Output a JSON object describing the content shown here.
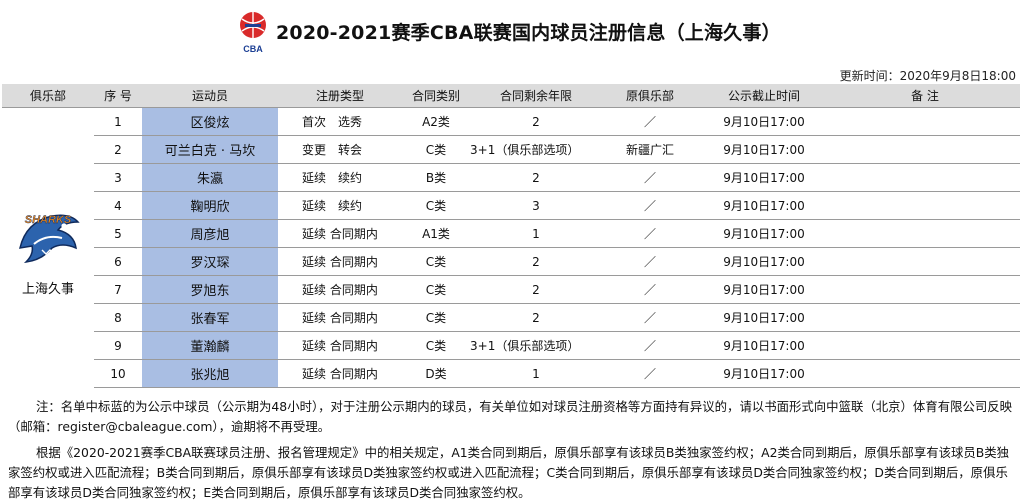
{
  "header": {
    "title": "2020-2021赛季CBA联赛国内球员注册信息（上海久事）",
    "updated_label": "更新时间：",
    "updated_value": "2020年9月8日18:00",
    "cba_logo_text": "CBA"
  },
  "table": {
    "columns": [
      "俱乐部",
      "序 号",
      "运动员",
      "注册类型",
      "合同类别",
      "合同剩余年限",
      "原俱乐部",
      "公示截止时间",
      "备 注"
    ],
    "club": {
      "name": "上海久事",
      "logo_text": "SHARKS"
    },
    "rows": [
      {
        "no": "1",
        "player": "区俊炫",
        "reg": "首次　选秀",
        "cat": "A2类",
        "years": "2",
        "prev": "／",
        "deadline": "9月10日17:00",
        "note": ""
      },
      {
        "no": "2",
        "player": "可兰白克 · 马坎",
        "reg": "变更　转会",
        "cat": "C类",
        "years": "3+1（俱乐部选项）",
        "prev": "新疆广汇",
        "deadline": "9月10日17:00",
        "note": ""
      },
      {
        "no": "3",
        "player": "朱瀛",
        "reg": "延续　续约",
        "cat": "B类",
        "years": "2",
        "prev": "／",
        "deadline": "9月10日17:00",
        "note": ""
      },
      {
        "no": "4",
        "player": "鞠明欣",
        "reg": "延续　续约",
        "cat": "C类",
        "years": "3",
        "prev": "／",
        "deadline": "9月10日17:00",
        "note": ""
      },
      {
        "no": "5",
        "player": "周彦旭",
        "reg": "延续 合同期内",
        "cat": "A1类",
        "years": "1",
        "prev": "／",
        "deadline": "9月10日17:00",
        "note": ""
      },
      {
        "no": "6",
        "player": "罗汉琛",
        "reg": "延续 合同期内",
        "cat": "C类",
        "years": "2",
        "prev": "／",
        "deadline": "9月10日17:00",
        "note": ""
      },
      {
        "no": "7",
        "player": "罗旭东",
        "reg": "延续 合同期内",
        "cat": "C类",
        "years": "2",
        "prev": "／",
        "deadline": "9月10日17:00",
        "note": ""
      },
      {
        "no": "8",
        "player": "张春军",
        "reg": "延续 合同期内",
        "cat": "C类",
        "years": "2",
        "prev": "／",
        "deadline": "9月10日17:00",
        "note": ""
      },
      {
        "no": "9",
        "player": "董瀚麟",
        "reg": "延续 合同期内",
        "cat": "C类",
        "years": "3+1（俱乐部选项）",
        "prev": "／",
        "deadline": "9月10日17:00",
        "note": ""
      },
      {
        "no": "10",
        "player": "张兆旭",
        "reg": "延续 合同期内",
        "cat": "D类",
        "years": "1",
        "prev": "／",
        "deadline": "9月10日17:00",
        "note": ""
      }
    ]
  },
  "notes": [
    "注：名单中标蓝的为公示中球员（公示期为48小时），对于注册公示期内的球员，有关单位如对球员注册资格等方面持有异议的，请以书面形式向中篮联（北京）体育有限公司反映（邮箱：register@cbaleague.com），逾期将不再受理。",
    "根据《2020-2021赛季CBA联赛球员注册、报名管理规定》中的相关规定，A1类合同到期后，原俱乐部享有该球员B类独家签约权；A2类合同到期后，原俱乐部享有该球员B类独家签约权或进入匹配流程；B类合同到期后，原俱乐部享有该球员D类独家签约权或进入匹配流程；C类合同到期后，原俱乐部享有该球员D类合同独家签约权；D类合同到期后，原俱乐部享有该球员D类合同独家签约权；E类合同到期后，原俱乐部享有该球员D类合同独家签约权。"
  ],
  "colors": {
    "highlight": "#a9bee3",
    "header_bg": "#dcdcdc",
    "cba_red": "#d92a2a",
    "cba_blue": "#1c3f94"
  }
}
